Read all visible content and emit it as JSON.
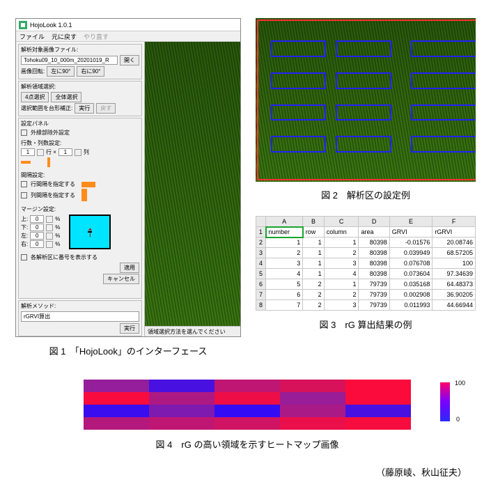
{
  "fig1": {
    "caption": "図 1　「HojoLook」のインターフェース",
    "window_title": "HojoLook 1.0.1",
    "menu": [
      "ファイル",
      "元に戻す",
      "やり直す"
    ],
    "grp_file": {
      "title": "解析対象画像ファイル:",
      "filename": "Tohoku09_10_000m_20201019_R",
      "open": "開く",
      "rotate_label": "画像回転:",
      "left90": "左に90°",
      "right90": "右に90°"
    },
    "grp_region": {
      "title": "解析領域選択:",
      "btn_4corner": "4点選択",
      "btn_all": "全体選択",
      "trapezoid_label": "選択範囲を台形補正:",
      "run": "実行",
      "back": "戻す"
    },
    "grp_settings": {
      "title": "設定パネル",
      "chk_outlier": "外縁部除外設定",
      "rowcol_title": "行数・列数設定:",
      "rows_val": "1",
      "rows_lbl": "行 ×",
      "cols_val": "1",
      "cols_lbl": "列",
      "gap_title": "間隔設定:",
      "chk_rowgap": "行間隔を指定する",
      "chk_colgap": "列間隔を指定する",
      "margin_title": "マージン設定:",
      "top_lbl": "上:",
      "top_val": "0",
      "bottom_lbl": "下:",
      "bottom_val": "0",
      "left_lbl": "左:",
      "left_val": "0",
      "right_lbl": "右:",
      "right_val": "0",
      "pct": "%",
      "chk_numbers": "各解析区に番号を表示する",
      "apply": "適用",
      "cancel": "キャンセル"
    },
    "grp_method": {
      "title": "解析メソッド:",
      "value": "rGRVI算出",
      "run": "実行"
    },
    "status": "領域選択方法を選んでください"
  },
  "fig2": {
    "caption": "図 2　解析区の設定例"
  },
  "fig3": {
    "caption": "図 3　rG 算出結果の例",
    "cols": [
      "",
      "A",
      "B",
      "C",
      "D",
      "E",
      "F"
    ],
    "headers": [
      "number",
      "row",
      "column",
      "area",
      "GRVI",
      "rGRVI"
    ],
    "rows": [
      [
        1,
        1,
        1,
        80398,
        -0.01576,
        20.08746
      ],
      [
        2,
        1,
        2,
        80398,
        0.039949,
        68.57205
      ],
      [
        3,
        1,
        3,
        80398,
        0.076708,
        100
      ],
      [
        4,
        1,
        4,
        80398,
        0.073604,
        97.34639
      ],
      [
        5,
        2,
        1,
        79739,
        0.035168,
        64.48373
      ],
      [
        6,
        2,
        2,
        79739,
        0.002908,
        36.90205
      ],
      [
        7,
        2,
        3,
        79739,
        0.011993,
        44.66944
      ]
    ]
  },
  "fig4": {
    "caption": "図 4　rG の高い領域を示すヒートマップ画像",
    "colorbar": {
      "max": "100",
      "min": "0"
    }
  },
  "chart_data": {
    "type": "heatmap",
    "title": "rG の高い領域を示すヒートマップ",
    "rows": 4,
    "cols": 5,
    "colormap": "blue-magenta-red",
    "range": [
      0,
      100
    ],
    "values": [
      [
        50,
        15,
        70,
        82,
        98
      ],
      [
        97,
        62,
        92,
        52,
        98
      ],
      [
        8,
        40,
        5,
        60,
        15
      ],
      [
        65,
        70,
        78,
        90,
        96
      ]
    ]
  },
  "credits": "（藤原崚、秋山征夫）"
}
